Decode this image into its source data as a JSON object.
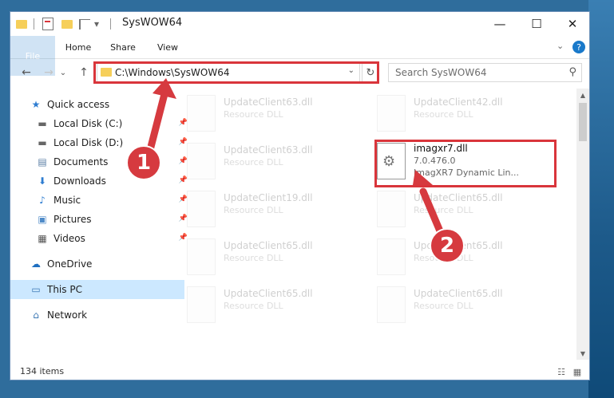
{
  "window": {
    "title": "SysWOW64",
    "controls": {
      "minimize": "—",
      "maximize": "☐",
      "close": "✕"
    }
  },
  "quick_access_toolbar": {
    "dropdown_glyph": "▾"
  },
  "ribbon": {
    "tabs": [
      {
        "label": "File",
        "active": true
      },
      {
        "label": "Home"
      },
      {
        "label": "Share"
      },
      {
        "label": "View"
      }
    ],
    "expand_glyph": "⌄",
    "help_glyph": "?"
  },
  "navigation": {
    "back_glyph": "←",
    "forward_glyph": "→",
    "recent_glyph": "⌄",
    "up_glyph": "↑",
    "address": "C:\\Windows\\SysWOW64",
    "address_dropdown_glyph": "⌄",
    "refresh_glyph": "↻",
    "search_placeholder": "Search SysWOW64",
    "search_icon_glyph": "⚲"
  },
  "sidebar": {
    "items": [
      {
        "label": "Quick access",
        "icon": "star-icon",
        "glyph": "★",
        "color": "#2e7dd1",
        "pinned": false
      },
      {
        "label": "Local Disk (C:)",
        "icon": "drive-icon",
        "glyph": "▬",
        "color": "#666666",
        "pinned": true
      },
      {
        "label": "Local Disk (D:)",
        "icon": "drive-icon",
        "glyph": "▬",
        "color": "#666666",
        "pinned": true
      },
      {
        "label": "Documents",
        "icon": "documents-icon",
        "glyph": "▤",
        "color": "#5b7fa6",
        "pinned": true
      },
      {
        "label": "Downloads",
        "icon": "downloads-icon",
        "glyph": "⬇",
        "color": "#2e7dd1",
        "pinned": true
      },
      {
        "label": "Music",
        "icon": "music-icon",
        "glyph": "♪",
        "color": "#2e7dd1",
        "pinned": true
      },
      {
        "label": "Pictures",
        "icon": "pictures-icon",
        "glyph": "▣",
        "color": "#4f8bc8",
        "pinned": true
      },
      {
        "label": "Videos",
        "icon": "videos-icon",
        "glyph": "▦",
        "color": "#555555",
        "pinned": true
      },
      {
        "label": "OneDrive",
        "icon": "onedrive-icon",
        "glyph": "☁",
        "color": "#1f6fc0",
        "pinned": false
      },
      {
        "label": "This PC",
        "icon": "pc-icon",
        "glyph": "▭",
        "color": "#3c78b4",
        "pinned": false
      },
      {
        "label": "Network",
        "icon": "network-icon",
        "glyph": "⌂",
        "color": "#3c78b4",
        "pinned": false
      }
    ],
    "pin_glyph": "📌"
  },
  "files": [
    {
      "name": "UpdateClient63.dll",
      "desc": "Resource DLL"
    },
    {
      "name": "UpdateClient42.dll",
      "desc": "Resource DLL"
    },
    {
      "name": "UpdateClient63.dll",
      "desc": "Resource DLL"
    },
    {
      "name": "imagxr7.dll",
      "version": "7.0.476.0",
      "desc": "ImagXR7 Dynamic Lin...",
      "highlighted": true
    },
    {
      "name": "UpdateClient19.dll",
      "desc": "Resource DLL"
    },
    {
      "name": "UpdateClient65.dll",
      "desc": "Resource DLL"
    },
    {
      "name": "UpdateClient65.dll",
      "desc": "Resource DLL"
    },
    {
      "name": "UpdateClient65.dll",
      "desc": "Resource DLL"
    },
    {
      "name": "UpdateClient65.dll",
      "desc": "Resource DLL"
    },
    {
      "name": "UpdateClient65.dll",
      "desc": "Resource DLL"
    }
  ],
  "scrollbar": {
    "up_glyph": "▲",
    "down_glyph": "▼"
  },
  "status_bar": {
    "item_count": "134 items",
    "details_view_glyph": "☷",
    "tiles_view_glyph": "▦"
  },
  "annotations": {
    "badge_1": "1",
    "badge_2": "2",
    "highlight_color": "#d9353b"
  }
}
